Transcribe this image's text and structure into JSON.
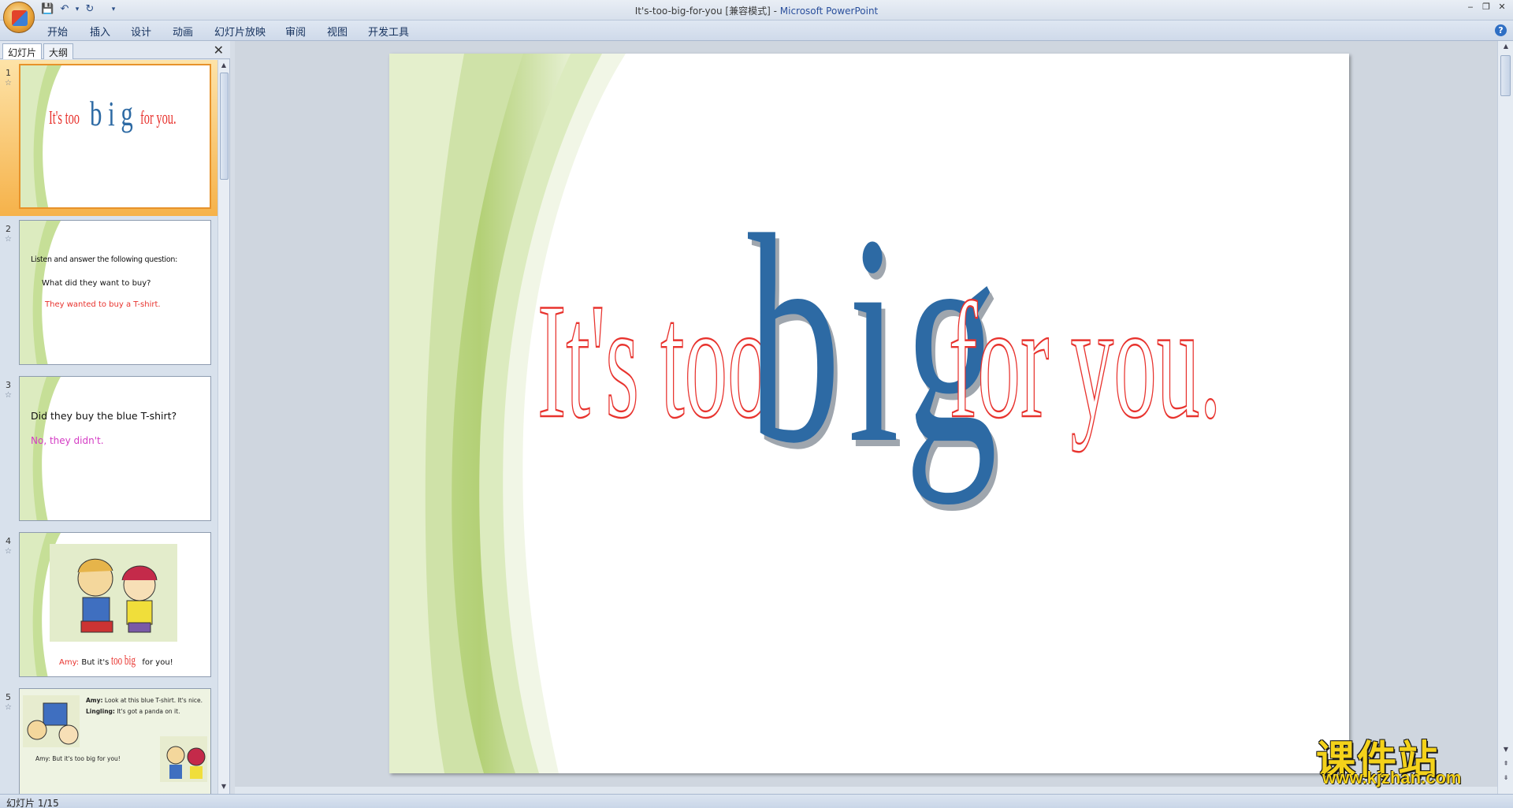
{
  "window": {
    "title_doc": "It's-too-big-for-you [兼容模式] - ",
    "title_app": "Microsoft PowerPoint"
  },
  "ribbon": {
    "tabs": [
      "开始",
      "插入",
      "设计",
      "动画",
      "幻灯片放映",
      "审阅",
      "视图",
      "开发工具"
    ]
  },
  "panel": {
    "tab_slides": "幻灯片",
    "tab_outline": "大纲",
    "close": "✕"
  },
  "thumbnails": [
    {
      "num": "1",
      "title_a": "It's too",
      "title_b": "b i g",
      "title_c": "for you."
    },
    {
      "num": "2",
      "line1": "Listen and answer the following question:",
      "line2": "What did they want to buy?",
      "line3": "They wanted to buy a T-shirt."
    },
    {
      "num": "3",
      "line1": "Did  they buy the blue T-shirt?",
      "line2": "No, they didn't."
    },
    {
      "num": "4",
      "caption_name": "Amy:",
      "caption_pre": " But it's ",
      "caption_big": "too big",
      "caption_post": " for you!"
    },
    {
      "num": "5",
      "l1_name": "Amy:",
      "l1": " Look at this blue T-shirt. It's nice.",
      "l2_name": "Lingling:",
      "l2": " It's got a panda on it.",
      "l3": "Amy: But it's too big for you!"
    }
  ],
  "slide": {
    "words_left": "It's too",
    "word_big_1": "b",
    "word_big_2": "i",
    "word_big_3": "g",
    "words_right": "for you."
  },
  "status": {
    "text": "幻灯片 1/15"
  },
  "watermark": {
    "cn": "课件站",
    "url": "www.kjzhan.com"
  },
  "colors": {
    "accent_red": "#e8332e",
    "big_blue": "#2d6aa4",
    "wave_green": "#b7d57c"
  }
}
